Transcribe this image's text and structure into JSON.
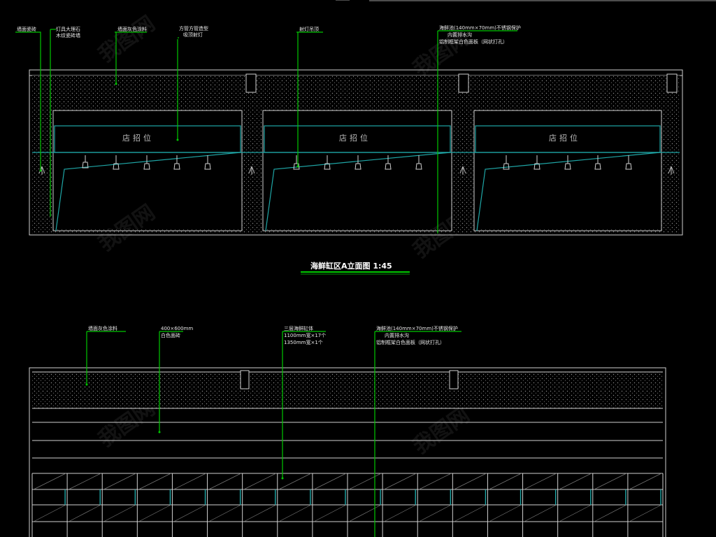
{
  "top_elevation": {
    "callouts": [
      {
        "lines": [
          "墙面瓷砖"
        ]
      },
      {
        "lines": [
          "灯具大理石",
          "木纹瓷砖墙"
        ]
      },
      {
        "lines": [
          "墙面灰色涂料"
        ]
      },
      {
        "lines": [
          "方管方管造型",
          "吸顶射灯"
        ]
      },
      {
        "lines": [
          "射灯吊顶"
        ]
      },
      {
        "lines": [
          "海鲜池(140mm×70mm)不锈钢保护",
          "内置排水沟",
          "铝制框架白色面板（网状打孔）"
        ]
      }
    ],
    "sign_text": "店招位",
    "title": "海鲜缸区A立面图 1:45"
  },
  "bottom_elevation": {
    "callouts": [
      {
        "lines": [
          "墙面灰色涂料"
        ]
      },
      {
        "lines": [
          "400×600mm",
          "白色面砖"
        ]
      },
      {
        "lines": [
          "三层海鲜缸体",
          "1100mm宽×17个",
          "1350mm宽×1个"
        ]
      },
      {
        "lines": [
          "海鲜池(140mm×70mm)不锈钢保护",
          "内置排水沟",
          "铝制框架白色面板（网状打孔）"
        ]
      }
    ]
  },
  "colors": {
    "background": "#000000",
    "outline": "#cfcfcf",
    "leader": "#00c800",
    "accent": "#1fa6a6",
    "text": "#e8e8e8"
  }
}
